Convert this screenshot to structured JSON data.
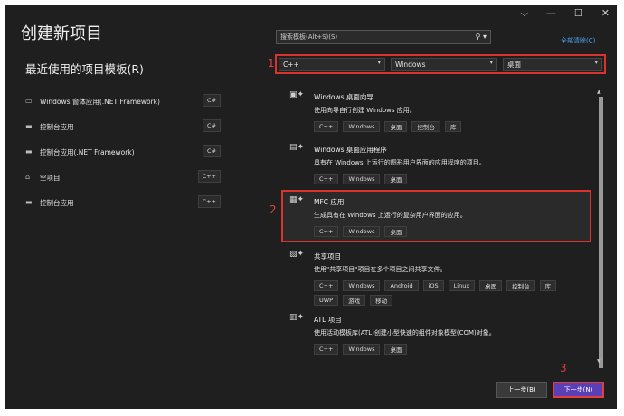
{
  "window": {
    "title": "创建新项目",
    "controls": [
      "⌵",
      "—",
      "☐",
      "✕"
    ]
  },
  "recent": {
    "title": "最近使用的项目模板(R)",
    "items": [
      {
        "label": "Windows 窗体应用(.NET Framework)",
        "tag": "C#",
        "icon": "form-icon"
      },
      {
        "label": "控制台应用",
        "tag": "C#",
        "icon": "console-icon"
      },
      {
        "label": "控制台应用(.NET Framework)",
        "tag": "C#",
        "icon": "console-icon"
      },
      {
        "label": "空项目",
        "tag": "C++",
        "icon": "empty-project-icon"
      },
      {
        "label": "控制台应用",
        "tag": "C++",
        "icon": "console-icon"
      }
    ]
  },
  "search": {
    "placeholder": "搜索模板(Alt+S)(S)",
    "clear_all": "全部清除(C)"
  },
  "filters": {
    "language": "C++",
    "platform": "Windows",
    "type": "桌面"
  },
  "annotations": {
    "a1": "1",
    "a2": "2",
    "a3": "3"
  },
  "templates": [
    {
      "name": "Windows 桌面向导",
      "desc": "使用向导自行创建 Windows 应用。",
      "tags": [
        "C++",
        "Windows",
        "桌面",
        "控制台",
        "库"
      ]
    },
    {
      "name": "Windows 桌面应用程序",
      "desc": "具有在 Windows 上运行的图形用户界面的应用程序的项目。",
      "tags": [
        "C++",
        "Windows",
        "桌面"
      ]
    },
    {
      "name": "MFC 应用",
      "desc": "生成具有在 Windows 上运行的复杂用户界面的应用。",
      "tags": [
        "C++",
        "Windows",
        "桌面"
      ]
    },
    {
      "name": "共享项目",
      "desc": "使用\"共享项目\"项目在多个项目之间共享文件。",
      "tags": [
        "C++",
        "Windows",
        "Android",
        "iOS",
        "Linux",
        "桌面",
        "控制台",
        "库",
        "UWP",
        "游戏",
        "移动"
      ]
    },
    {
      "name": "ATL 项目",
      "desc": "使用活动模板库(ATL)创建小型快速的组件对象模型(COM)对象。",
      "tags": [
        "C++",
        "Windows",
        "桌面"
      ]
    }
  ],
  "buttons": {
    "back": "上一步(B)",
    "next": "下一步(N)"
  }
}
